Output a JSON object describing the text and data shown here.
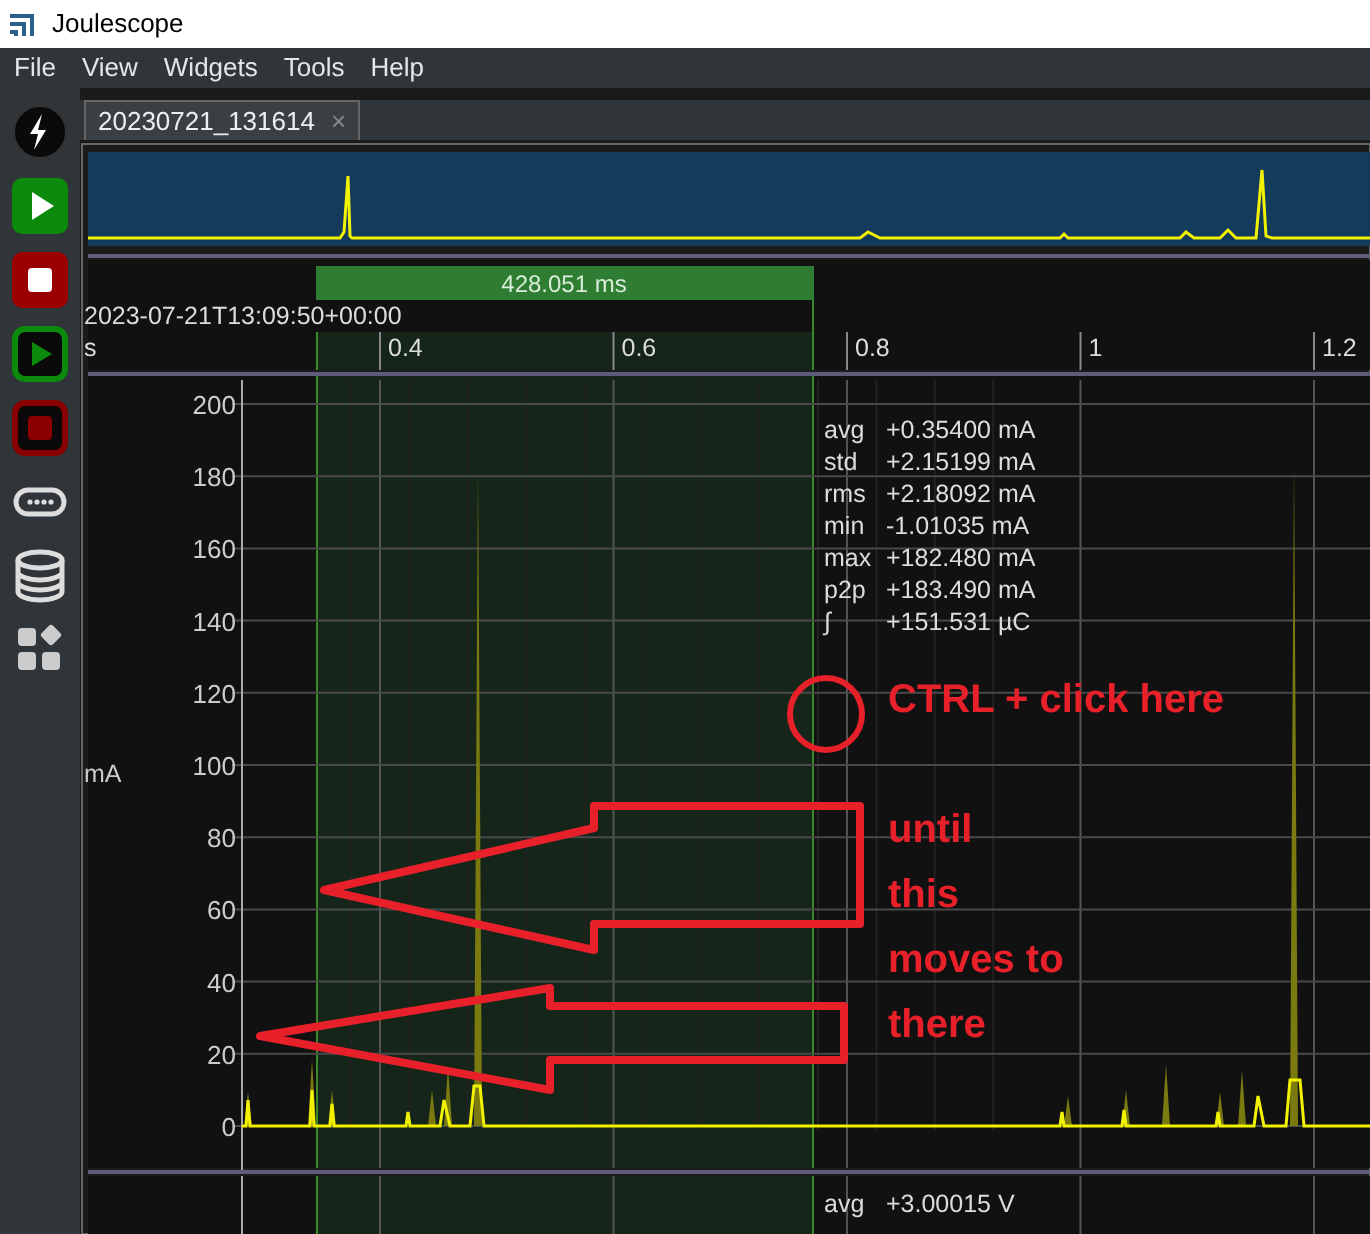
{
  "window": {
    "title": "Joulescope"
  },
  "menu": [
    "File",
    "View",
    "Widgets",
    "Tools",
    "Help"
  ],
  "sidebar": [
    {
      "kind": "bolt"
    },
    {
      "kind": "play",
      "outlined": false
    },
    {
      "kind": "stop",
      "outlined": false
    },
    {
      "kind": "play",
      "outlined": true
    },
    {
      "kind": "stop",
      "outlined": true
    },
    {
      "kind": "device"
    },
    {
      "kind": "storage"
    },
    {
      "kind": "widgets"
    }
  ],
  "tabs": [
    {
      "label": "20230721_131614",
      "close": "×",
      "selected": true
    }
  ],
  "marker": {
    "label": "428.051 ms"
  },
  "timestamp": "2023-07-21T13:09:50+00:00",
  "x_axis": {
    "unit": "s",
    "ticks": [
      "0.4",
      "0.6",
      "0.8",
      "1",
      "1.2"
    ]
  },
  "current_plot": {
    "unit": "mA",
    "yticks": [
      "200",
      "180",
      "160",
      "140",
      "120",
      "100",
      "80",
      "60",
      "40",
      "20",
      "0"
    ],
    "stats": [
      {
        "label": "avg",
        "value": "+0.35400  mA"
      },
      {
        "label": "std",
        "value": "+2.15199  mA"
      },
      {
        "label": "rms",
        "value": "+2.18092  mA"
      },
      {
        "label": "min",
        "value": "-1.01035  mA"
      },
      {
        "label": "max",
        "value": "+182.480  mA"
      },
      {
        "label": "p2p",
        "value": "+183.490  mA"
      },
      {
        "label": "∫",
        "value": "+151.531  µC"
      }
    ]
  },
  "voltage_plot": {
    "stats": [
      {
        "label": "avg",
        "value": "+3.00015  V"
      }
    ]
  },
  "annotations": {
    "click_note": "CTRL + click here",
    "lines": [
      "until",
      "this",
      "moves to",
      "there"
    ]
  }
}
